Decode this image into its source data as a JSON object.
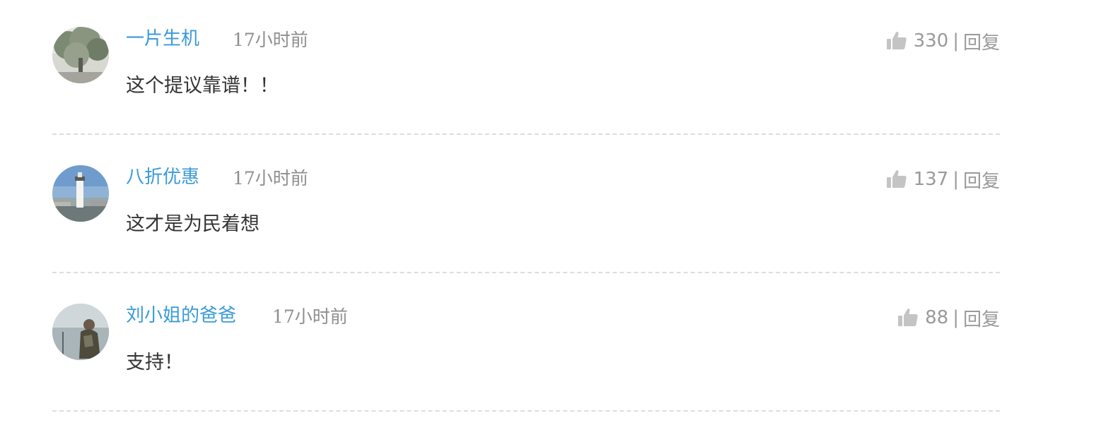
{
  "comments": [
    {
      "username": "一片生机",
      "time": "17小时前",
      "likes": "330",
      "separator": "|",
      "reply_label": "回复",
      "content": "这个提议靠谱！！",
      "avatar_icon": "tree-photo-avatar"
    },
    {
      "username": "八折优惠",
      "time": "17小时前",
      "likes": "137",
      "separator": "|",
      "reply_label": "回复",
      "content": "这才是为民着想",
      "avatar_icon": "lighthouse-photo-avatar"
    },
    {
      "username": "刘小姐的爸爸",
      "time": "17小时前",
      "likes": "88",
      "separator": "|",
      "reply_label": "回复",
      "content": "支持！",
      "avatar_icon": "person-lake-photo-avatar"
    }
  ],
  "colors": {
    "username": "#3a9ad9",
    "time": "#8e8e8e",
    "meta": "#9a9a9a",
    "content": "#333333",
    "divider": "#dddddd"
  }
}
